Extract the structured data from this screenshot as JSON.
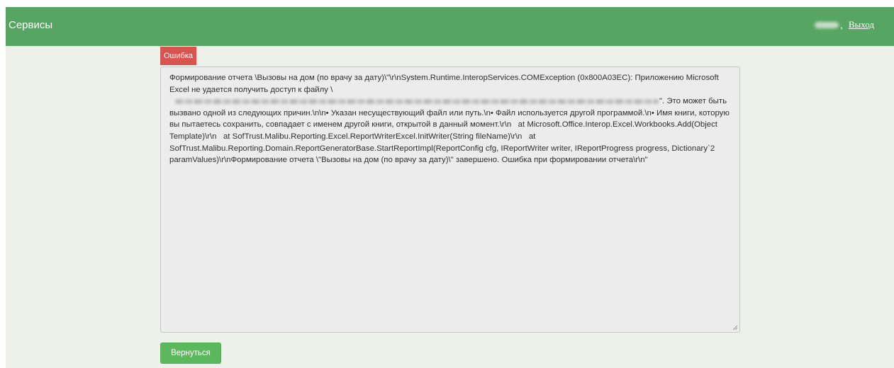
{
  "header": {
    "brand": "Сервисы",
    "separator": ",",
    "logout_label": "Выход"
  },
  "error": {
    "badge": "Ошибка",
    "message_before_path": "Формирование отчета \\Вызовы на дом (по врачу за дату)\\\"\\r\\nSystem.Runtime.InteropServices.COMException (0x800A03EC): Приложению Microsoft Excel не удается получить доступ к файлу \\",
    "message_after_path": "\". Это может быть вызвано одной из следующих причин.\\n\\n• Указан несуществующий файл или путь.\\n• Файл используется другой программой.\\n• Имя книги, которую вы пытаетесь сохранить, совпадает с именем другой книги, открытой в данный момент.\\r\\n   at Microsoft.Office.Interop.Excel.Workbooks.Add(Object Template)\\r\\n   at SofTrust.Malibu.Reporting.Excel.ReportWriterExcel.InitWriter(String fileName)\\r\\n   at SofTrust.Malibu.Reporting.Domain.ReportGeneratorBase.StartReportImpl(ReportConfig cfg, IReportWriter writer, IReportProgress progress, Dictionary`2 paramValues)\\r\\nФормирование отчета \\\"Вызовы на дом (по врачу за дату)\\\" завершено. Ошибка при формировании отчета\\r\\n\""
  },
  "actions": {
    "back_label": "Вернуться"
  },
  "colors": {
    "navbar": "#57a562",
    "background": "#eef1ea",
    "error_badge": "#d9534f",
    "button": "#5cb85c"
  }
}
